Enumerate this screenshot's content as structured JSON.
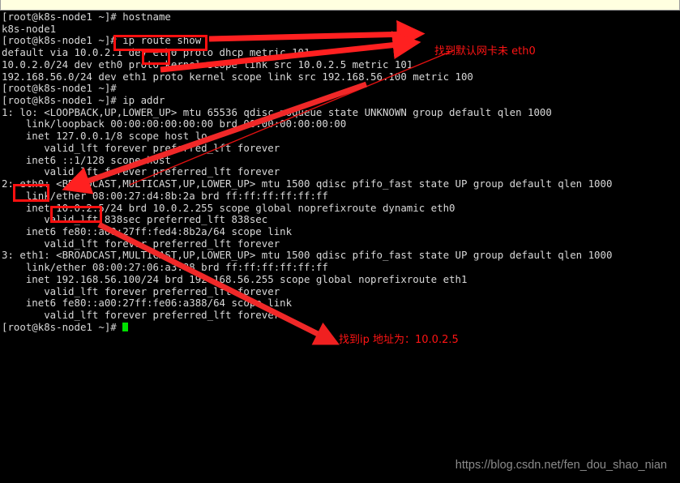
{
  "window": {
    "topbar_color": "#ffffe0",
    "background": "#000000",
    "foreground": "#d8d8d8"
  },
  "terminal": {
    "prompt": "[root@k8s-node1 ~]#",
    "lines": [
      "[root@k8s-node1 ~]# hostname",
      "k8s-node1",
      "[root@k8s-node1 ~]# ip route show",
      "default via 10.0.2.1 dev eth0 proto dhcp metric 101",
      "10.0.2.0/24 dev eth0 proto kernel scope link src 10.0.2.5 metric 101",
      "192.168.56.0/24 dev eth1 proto kernel scope link src 192.168.56.100 metric 100",
      "[root@k8s-node1 ~]#",
      "[root@k8s-node1 ~]# ip addr",
      "1: lo: <LOOPBACK,UP,LOWER_UP> mtu 65536 qdisc noqueue state UNKNOWN group default qlen 1000",
      "    link/loopback 00:00:00:00:00:00 brd 00:00:00:00:00:00",
      "    inet 127.0.0.1/8 scope host lo",
      "       valid_lft forever preferred_lft forever",
      "    inet6 ::1/128 scope host",
      "       valid_lft forever preferred_lft forever",
      "2: eth0: <BROADCAST,MULTICAST,UP,LOWER_UP> mtu 1500 qdisc pfifo_fast state UP group default qlen 1000",
      "    link/ether 08:00:27:d4:8b:2a brd ff:ff:ff:ff:ff:ff",
      "    inet 10.0.2.5/24 brd 10.0.2.255 scope global noprefixroute dynamic eth0",
      "       valid_lft 838sec preferred_lft 838sec",
      "    inet6 fe80::a00:27ff:fed4:8b2a/64 scope link",
      "       valid_lft forever preferred_lft forever",
      "3: eth1: <BROADCAST,MULTICAST,UP,LOWER_UP> mtu 1500 qdisc pfifo_fast state UP group default qlen 1000",
      "    link/ether 08:00:27:06:a3:88 brd ff:ff:ff:ff:ff:ff",
      "    inet 192.168.56.100/24 brd 192.168.56.255 scope global noprefixroute eth1",
      "       valid_lft forever preferred_lft forever",
      "    inet6 fe80::a00:27ff:fe06:a388/64 scope link",
      "       valid_lft forever preferred_lft forever"
    ],
    "last_prompt": "[root@k8s-node1 ~]# ",
    "cursor_color": "#00e000"
  },
  "annotations": {
    "color": "#ff1414",
    "highlights": [
      {
        "name": "ip-route-show-command",
        "text": "ip route show"
      },
      {
        "name": "eth0-route-device",
        "text": "eth0"
      },
      {
        "name": "eth0-interface-name",
        "text": "eth0:"
      },
      {
        "name": "eth0-ip-address",
        "text": "10.0.2.5"
      }
    ],
    "notes": [
      {
        "name": "default-nic-note",
        "text": "找到默认网卡未 eth0"
      },
      {
        "name": "ip-address-note",
        "text": "找到ip 地址为：10.0.2.5"
      }
    ]
  },
  "watermark": {
    "text": "https://blog.csdn.net/fen_dou_shao_nian"
  }
}
